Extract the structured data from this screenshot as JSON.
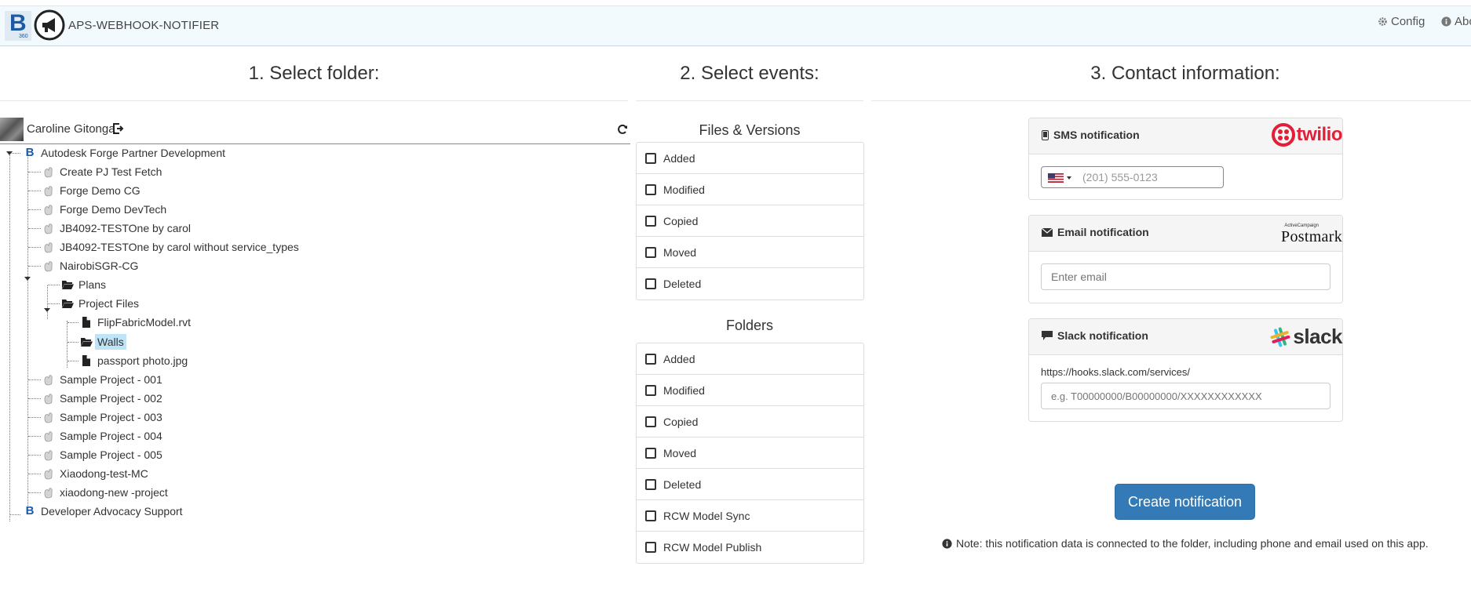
{
  "navbar": {
    "title": "APS-WEBHOOK-NOTIFIER",
    "logo_letter": "B",
    "logo_sub": "360",
    "config_label": "Config",
    "about_label": "Abo"
  },
  "columns": {
    "folder_title": "1. Select folder:",
    "events_title": "2. Select events:",
    "contact_title": "3. Contact information:"
  },
  "user": {
    "name": "Caroline Gitonga"
  },
  "tree": [
    {
      "label": "Autodesk Forge Partner Development",
      "type": "hub"
    },
    {
      "label": "Create PJ Test Fetch",
      "type": "project"
    },
    {
      "label": "Forge Demo CG",
      "type": "project"
    },
    {
      "label": "Forge Demo DevTech",
      "type": "project"
    },
    {
      "label": "JB4092-TESTOne by carol",
      "type": "project"
    },
    {
      "label": "JB4092-TESTOne by carol without service_types",
      "type": "project"
    },
    {
      "label": "NairobiSGR-CG",
      "type": "project"
    },
    {
      "label": "Plans",
      "type": "folder"
    },
    {
      "label": "Project Files",
      "type": "folder"
    },
    {
      "label": "FlipFabricModel.rvt",
      "type": "file"
    },
    {
      "label": "Walls",
      "type": "folder",
      "selected": true
    },
    {
      "label": "passport photo.jpg",
      "type": "file"
    },
    {
      "label": "Sample Project - 001",
      "type": "project"
    },
    {
      "label": "Sample Project - 002",
      "type": "project"
    },
    {
      "label": "Sample Project - 003",
      "type": "project"
    },
    {
      "label": "Sample Project - 004",
      "type": "project"
    },
    {
      "label": "Sample Project - 005",
      "type": "project"
    },
    {
      "label": "Xiaodong-test-MC",
      "type": "project"
    },
    {
      "label": "xiaodong-new -project",
      "type": "project"
    },
    {
      "label": "Developer Advocacy Support",
      "type": "hub"
    }
  ],
  "events": {
    "files_heading": "Files & Versions",
    "files": [
      "Added",
      "Modified",
      "Copied",
      "Moved",
      "Deleted"
    ],
    "folders_heading": "Folders",
    "folders": [
      "Added",
      "Modified",
      "Copied",
      "Moved",
      "Deleted",
      "RCW Model Sync",
      "RCW Model Publish"
    ]
  },
  "contact": {
    "sms": {
      "title": "SMS notification",
      "brand": "twilio",
      "placeholder": "(201) 555-0123",
      "country": "US"
    },
    "email": {
      "title": "Email notification",
      "brand": "Postmark",
      "brand_small": "ActiveCampaign",
      "placeholder": "Enter email"
    },
    "slack": {
      "title": "Slack notification",
      "brand": "slack",
      "prefix": "https://hooks.slack.com/services/",
      "placeholder": "e.g. T00000000/B00000000/XXXXXXXXXXXX"
    },
    "create_label": "Create notification",
    "note": "Note: this notification data is connected to the folder, including phone and email used on this app."
  },
  "colors": {
    "accent": "#337ab7",
    "twilio": "#e31e38",
    "selected": "#bde4f7",
    "navbar_bg": "#f3fafd"
  }
}
